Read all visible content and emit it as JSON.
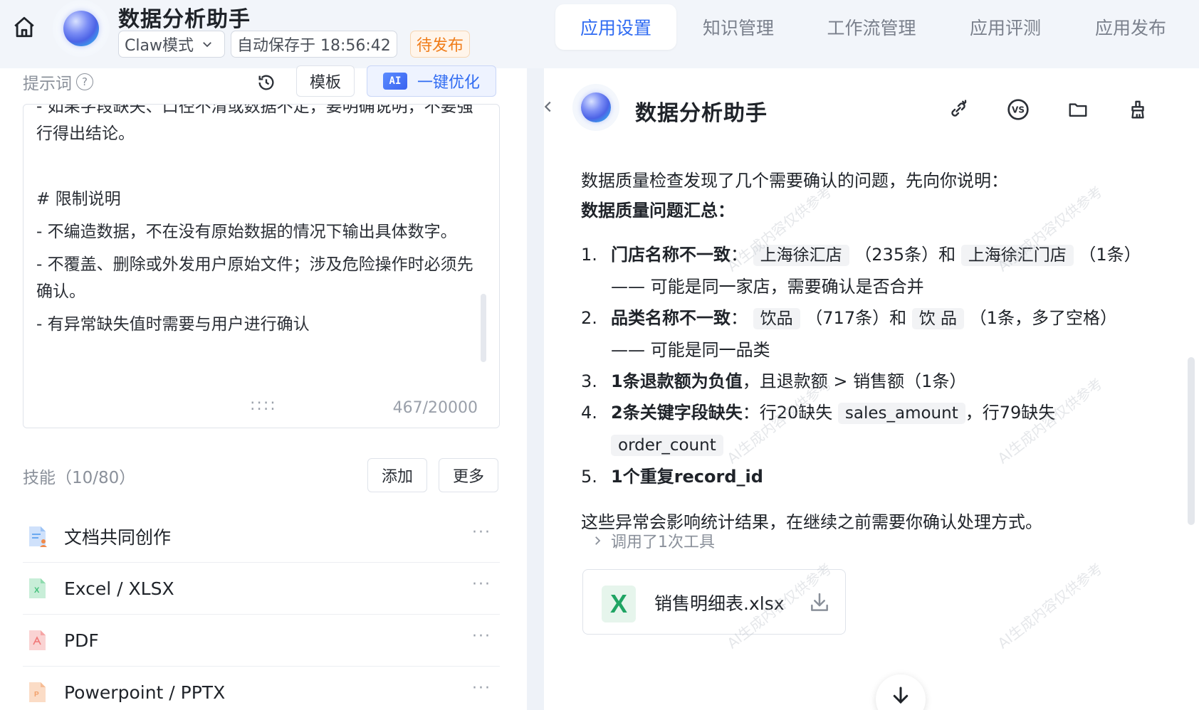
{
  "header": {
    "title": "数据分析助手",
    "mode": "Claw模式",
    "autosave": "自动保存于 18:56:42",
    "status": "待发布",
    "tabs": [
      {
        "label": "应用设置",
        "active": true
      },
      {
        "label": "知识管理",
        "active": false
      },
      {
        "label": "工作流管理",
        "active": false
      },
      {
        "label": "应用评测",
        "active": false
      },
      {
        "label": "应用发布",
        "active": false
      }
    ]
  },
  "prompt": {
    "label": "提示词",
    "template_label": "模板",
    "ai_badge": "AI",
    "optimize_label": "一键优化",
    "lines": [
      "- 如果字段缺失、口径不清或数据不足，要明确说明，不要强行得出结论。",
      "# 限制说明",
      "- 不编造数据，不在没有原始数据的情况下输出具体数字。",
      "- 不覆盖、删除或外发用户原始文件；涉及危险操作时必须先确认。",
      "- 有异常缺失值时需要与用户进行确认"
    ],
    "char_count": "467/20000"
  },
  "skills": {
    "label": "技能（10/80）",
    "add_label": "添加",
    "more_label": "更多",
    "items": [
      {
        "name": "文档共同创作",
        "icon": "doc-coauthor-icon",
        "color": "#6aa8f0"
      },
      {
        "name": "Excel / XLSX",
        "icon": "excel-file-icon",
        "color": "#43c07a"
      },
      {
        "name": "PDF",
        "icon": "pdf-file-icon",
        "color": "#f07878"
      },
      {
        "name": "Powerpoint / PPTX",
        "icon": "ppt-file-icon",
        "color": "#f2a06a"
      }
    ]
  },
  "chat": {
    "title": "数据分析助手",
    "intro": "数据质量检查发现了几个需要确认的问题，先向你说明：",
    "heading": "数据质量问题汇总：",
    "issues": [
      {
        "num": "1.",
        "bold": "门店名称不一致",
        "sep": "：",
        "code1": "上海徐汇店",
        "mid": "（235条）和",
        "code2": "上海徐汇门店",
        "tail": "（1条）—— 可能是同一家店，需要确认是否合并"
      },
      {
        "num": "2.",
        "bold": "品类名称不一致",
        "sep": "：",
        "code1": "饮品",
        "mid": "（717条）和",
        "code2": "饮 品",
        "tail": "（1条，多了空格）—— 可能是同一品类"
      },
      {
        "num": "3.",
        "bold": "1条退款额为负值",
        "tail": "，且退款额 > 销售额（1条）"
      },
      {
        "num": "4.",
        "bold": "2条关键字段缺失",
        "sep": "：",
        "pre": "行20缺失",
        "code1": "sales_amount",
        "mid": "，行79缺失",
        "code2": "order_count"
      },
      {
        "num": "5.",
        "bold": "1个重复record_id"
      }
    ],
    "outro": "这些异常会影响统计结果，在继续之前需要你确认处理方式。",
    "tool_call": "调用了1次工具",
    "file_name": "销售明细表.xlsx",
    "file_badge": "X",
    "watermark": "AI生成内容仅供参考"
  },
  "colors": {
    "accent": "#2f6bf2",
    "pending": "#f07d1a",
    "excel": "#1fa463"
  }
}
